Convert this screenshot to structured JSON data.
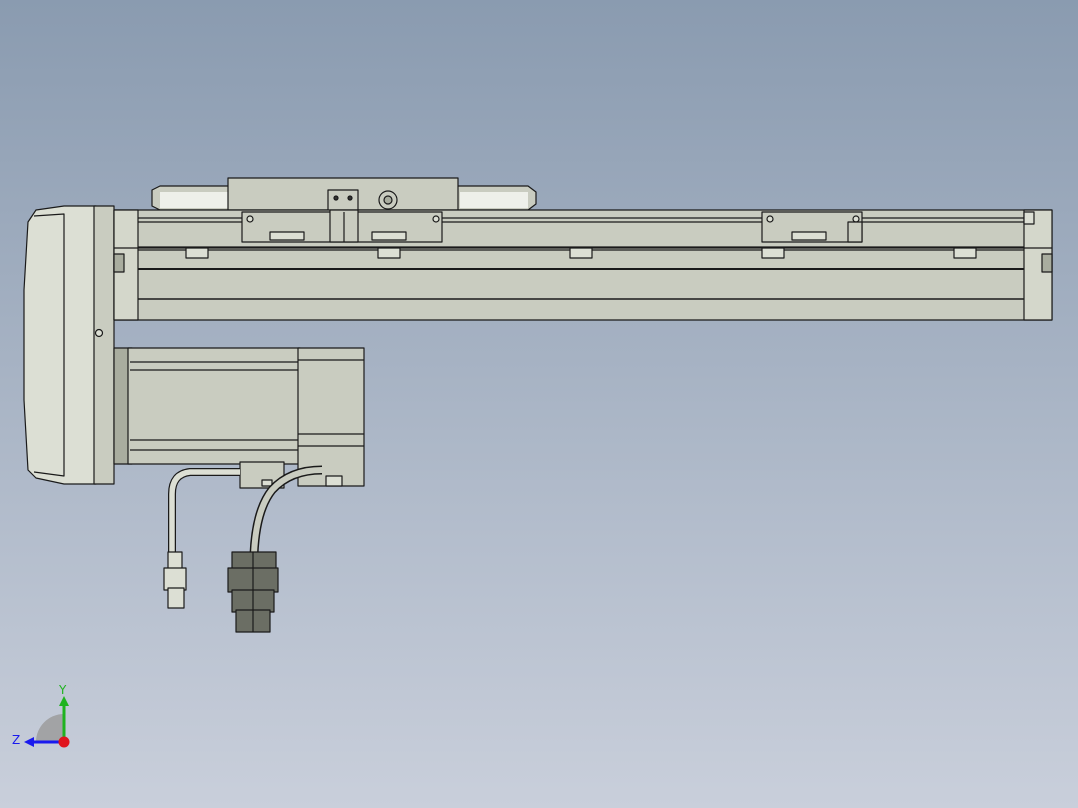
{
  "colors": {
    "bg_top": "#8a9bb0",
    "bg_bottom": "#c9cfdb",
    "metal": "#c9ccc0",
    "metal_light": "#dcdfd4",
    "metal_dark": "#a9ad9f",
    "connector": "#6b6e64",
    "edge": "#1a1a1a",
    "axis_x": "#e0141e",
    "axis_y": "#1fb31f",
    "axis_z": "#1a1aee",
    "triad_shade": "#9c9c9c"
  },
  "triad": {
    "y_label": "Y",
    "z_label": "Z"
  }
}
